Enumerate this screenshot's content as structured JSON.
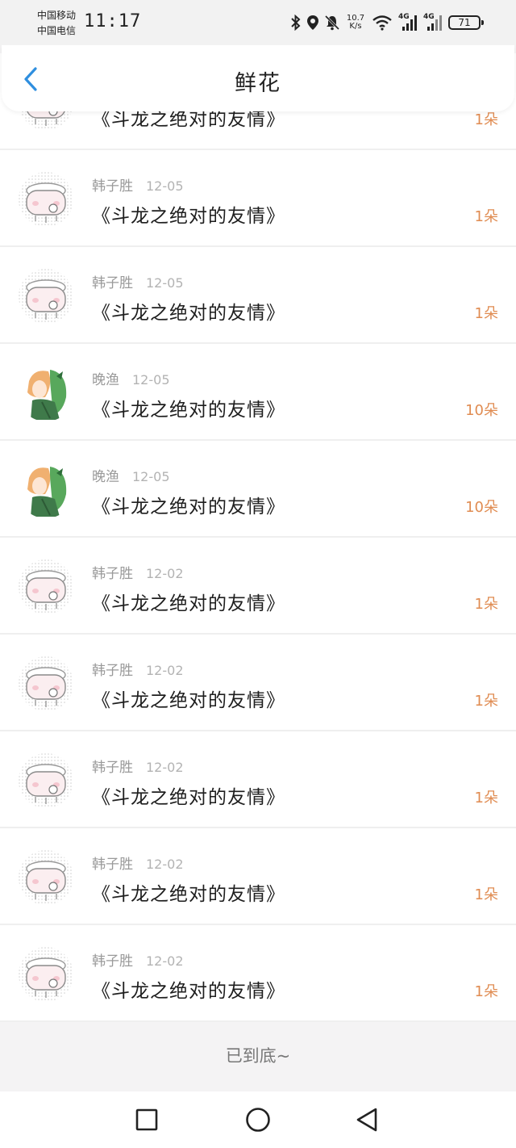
{
  "status_bar": {
    "carrier_1": "中国移动",
    "carrier_2": "中国电信",
    "time": "11:17",
    "net_speed_value": "10.7",
    "net_speed_unit": "K/s",
    "signal_1": "4G",
    "signal_2": "4G",
    "battery": "71"
  },
  "header": {
    "title": "鲜花"
  },
  "list": [
    {
      "user": "",
      "date": "",
      "book": "《斗龙之绝对的友情》",
      "count": "1朵",
      "avatar": "cartoon-avatar"
    },
    {
      "user": "韩子胜",
      "date": "12-05",
      "book": "《斗龙之绝对的友情》",
      "count": "1朵",
      "avatar": "cartoon-avatar"
    },
    {
      "user": "韩子胜",
      "date": "12-05",
      "book": "《斗龙之绝对的友情》",
      "count": "1朵",
      "avatar": "cartoon-avatar"
    },
    {
      "user": "晚渔",
      "date": "12-05",
      "book": "《斗龙之绝对的友情》",
      "count": "10朵",
      "avatar": "anime-avatar"
    },
    {
      "user": "晚渔",
      "date": "12-05",
      "book": "《斗龙之绝对的友情》",
      "count": "10朵",
      "avatar": "anime-avatar"
    },
    {
      "user": "韩子胜",
      "date": "12-02",
      "book": "《斗龙之绝对的友情》",
      "count": "1朵",
      "avatar": "cartoon-avatar"
    },
    {
      "user": "韩子胜",
      "date": "12-02",
      "book": "《斗龙之绝对的友情》",
      "count": "1朵",
      "avatar": "cartoon-avatar"
    },
    {
      "user": "韩子胜",
      "date": "12-02",
      "book": "《斗龙之绝对的友情》",
      "count": "1朵",
      "avatar": "cartoon-avatar"
    },
    {
      "user": "韩子胜",
      "date": "12-02",
      "book": "《斗龙之绝对的友情》",
      "count": "1朵",
      "avatar": "cartoon-avatar"
    },
    {
      "user": "韩子胜",
      "date": "12-02",
      "book": "《斗龙之绝对的友情》",
      "count": "1朵",
      "avatar": "cartoon-avatar"
    }
  ],
  "footer": {
    "end_text": "已到底~"
  },
  "nav_bar": {
    "buttons": [
      "recent-apps",
      "home",
      "back"
    ]
  },
  "colors": {
    "accent": "#2f8fdf",
    "count": "#e08c52",
    "title": "#222222"
  }
}
